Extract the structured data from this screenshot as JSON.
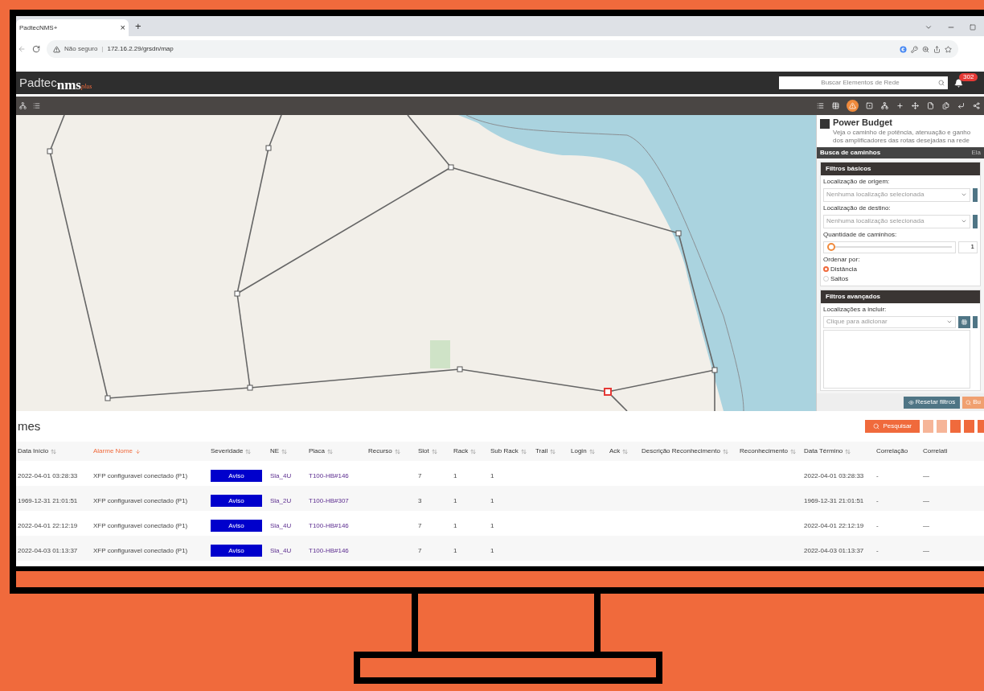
{
  "browser": {
    "tab": {
      "title": "PadtecNMS+",
      "close": "×",
      "new": "+"
    },
    "security": "Não seguro",
    "separator": "|",
    "url": "172.16.2.29/grsdn/map"
  },
  "app": {
    "logo": {
      "brand": "Padtec",
      "product": "nms",
      "suffix": "plus"
    },
    "search": {
      "placeholder": "Buscar Elementos de Rede"
    },
    "notifications": "302"
  },
  "toolbar": [
    {
      "kind": "list",
      "selected": false
    },
    {
      "kind": "table",
      "selected": false
    },
    {
      "kind": "alert",
      "selected": true
    },
    {
      "kind": "square",
      "selected": false
    },
    {
      "kind": "network",
      "selected": false
    },
    {
      "kind": "plus",
      "selected": false
    },
    {
      "kind": "move",
      "selected": false
    },
    {
      "kind": "file",
      "selected": false
    },
    {
      "kind": "files",
      "selected": false
    },
    {
      "kind": "corner",
      "selected": false
    },
    {
      "kind": "share",
      "selected": false
    }
  ],
  "panel": {
    "title": "Power Budget",
    "subtitle": "Veja o caminho de potência, atenuação e ganho dos amplificadores das rotas desejadas na rede",
    "tabs": [
      {
        "label": "Busca de caminhos",
        "selected": true
      },
      {
        "label": "Ela",
        "selected": false
      }
    ],
    "basic": {
      "title": "Filtros básicos",
      "origin": {
        "label": "Localização de origem:",
        "placeholder": "Nenhuma localização selecionada"
      },
      "destination": {
        "label": "Localização de destino:",
        "placeholder": "Nenhuma localização selecionada"
      },
      "paths": {
        "label": "Quantidade de caminhos:",
        "level": 0,
        "value": "1"
      },
      "order": {
        "label": "Ordenar por:",
        "options": [
          {
            "label": "Distância",
            "selected": true
          },
          {
            "label": "Saltos",
            "selected": false
          }
        ]
      }
    },
    "advanced": {
      "title": "Filtros avançados",
      "include": {
        "label": "Localizações a incluir:",
        "placeholder": "Clique para adicionar"
      }
    },
    "buttons": [
      {
        "label": "Resetar filtros",
        "kind": "reset"
      },
      {
        "label": "Bu",
        "kind": "search"
      }
    ]
  },
  "alarms": {
    "title": "mes",
    "search_button": "Pesquisar",
    "columns": [
      {
        "label": "Data Início",
        "sortable": true,
        "sorted": false
      },
      {
        "label": "Alarme Nome",
        "sortable": true,
        "sorted": true
      },
      {
        "label": "Severidade",
        "sortable": true,
        "sorted": false
      },
      {
        "label": "NE",
        "sortable": true,
        "sorted": false
      },
      {
        "label": "Placa",
        "sortable": true,
        "sorted": false
      },
      {
        "label": "Recurso",
        "sortable": true,
        "sorted": false
      },
      {
        "label": "Slot",
        "sortable": true,
        "sorted": false
      },
      {
        "label": "Rack",
        "sortable": true,
        "sorted": false
      },
      {
        "label": "Sub Rack",
        "sortable": true,
        "sorted": false
      },
      {
        "label": "Trail",
        "sortable": true,
        "sorted": false
      },
      {
        "label": "Login",
        "sortable": true,
        "sorted": false
      },
      {
        "label": "Ack",
        "sortable": true,
        "sorted": false
      },
      {
        "label": "Descrição Reconhecimento",
        "sortable": true,
        "sorted": false
      },
      {
        "label": "Reconhecimento",
        "sortable": true,
        "sorted": false
      },
      {
        "label": "Data Término",
        "sortable": true,
        "sorted": false
      },
      {
        "label": "Correlação",
        "sortable": false,
        "sorted": false
      },
      {
        "label": "Correlati",
        "sortable": false,
        "sorted": false
      }
    ],
    "rows": [
      {
        "start": "2022-04-01 03:28:33",
        "name": "XFP configuravel conectado (P1)",
        "severity": "Aviso",
        "ne": "Sla_4U",
        "board": "T100-HB#146",
        "slot": "7",
        "rack": "1",
        "subrack": "1",
        "end": "2022-04-01 03:28:33",
        "correlation": "-",
        "correlation_2": "—"
      },
      {
        "start": "1969-12-31 21:01:51",
        "name": "XFP configuravel conectado (P1)",
        "severity": "Aviso",
        "ne": "Sla_2U",
        "board": "T100-HB#307",
        "slot": "3",
        "rack": "1",
        "subrack": "1",
        "end": "1969-12-31 21:01:51",
        "correlation": "-",
        "correlation_2": "—"
      },
      {
        "start": "2022-04-01 22:12:19",
        "name": "XFP configuravel conectado (P1)",
        "severity": "Aviso",
        "ne": "Sla_4U",
        "board": "T100-HB#146",
        "slot": "7",
        "rack": "1",
        "subrack": "1",
        "end": "2022-04-01 22:12:19",
        "correlation": "-",
        "correlation_2": "—"
      },
      {
        "start": "2022-04-03 01:13:37",
        "name": "XFP configuravel conectado (P1)",
        "severity": "Aviso",
        "ne": "Sla_4U",
        "board": "T100-HB#146",
        "slot": "7",
        "rack": "1",
        "subrack": "1",
        "end": "2022-04-03 01:13:37",
        "correlation": "-",
        "correlation_2": "—"
      }
    ]
  }
}
